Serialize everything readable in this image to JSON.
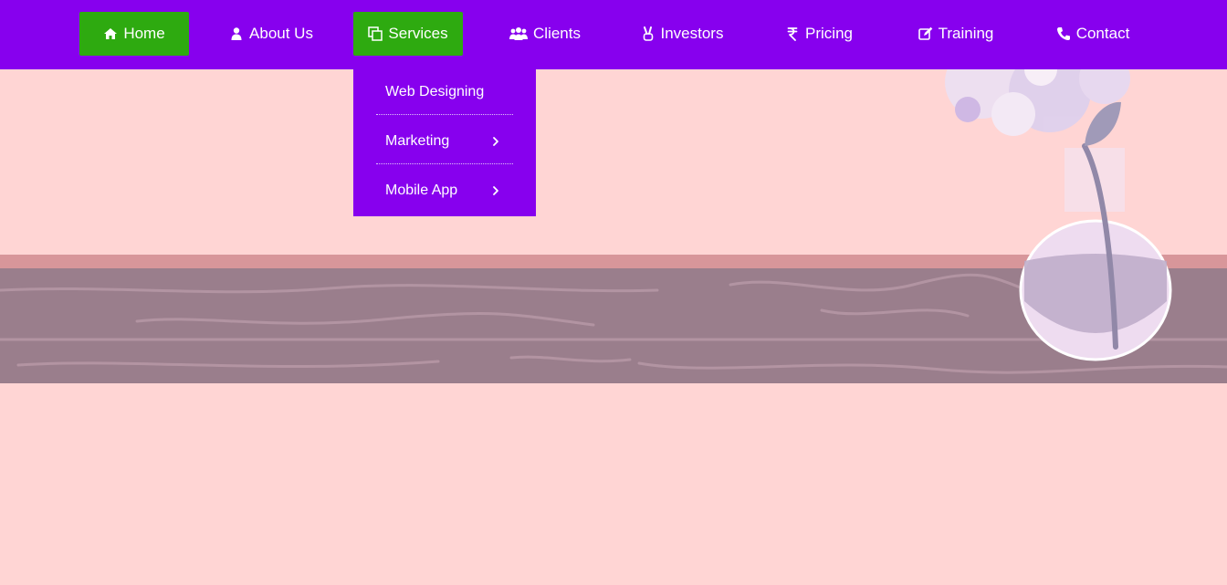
{
  "nav": {
    "items": [
      {
        "label": "Home",
        "icon": "home-icon",
        "active": true
      },
      {
        "label": "About Us",
        "icon": "user-icon",
        "active": false
      },
      {
        "label": "Services",
        "icon": "copy-icon",
        "active": true
      },
      {
        "label": "Clients",
        "icon": "users-icon",
        "active": false
      },
      {
        "label": "Investors",
        "icon": "peace-hand-icon",
        "active": false
      },
      {
        "label": "Pricing",
        "icon": "rupee-icon",
        "active": false
      },
      {
        "label": "Training",
        "icon": "edit-icon",
        "active": false
      },
      {
        "label": "Contact",
        "icon": "phone-icon",
        "active": false
      }
    ]
  },
  "services_menu": {
    "items": [
      {
        "label": "Web Designing",
        "has_submenu": false
      },
      {
        "label": "Marketing",
        "has_submenu": true
      },
      {
        "label": "Mobile App",
        "has_submenu": true
      }
    ]
  },
  "colors": {
    "navbar": "#8700ee",
    "active_item": "#2eaa10",
    "page_background": "#ffd5d4",
    "shelf": "#9a7e8c"
  }
}
